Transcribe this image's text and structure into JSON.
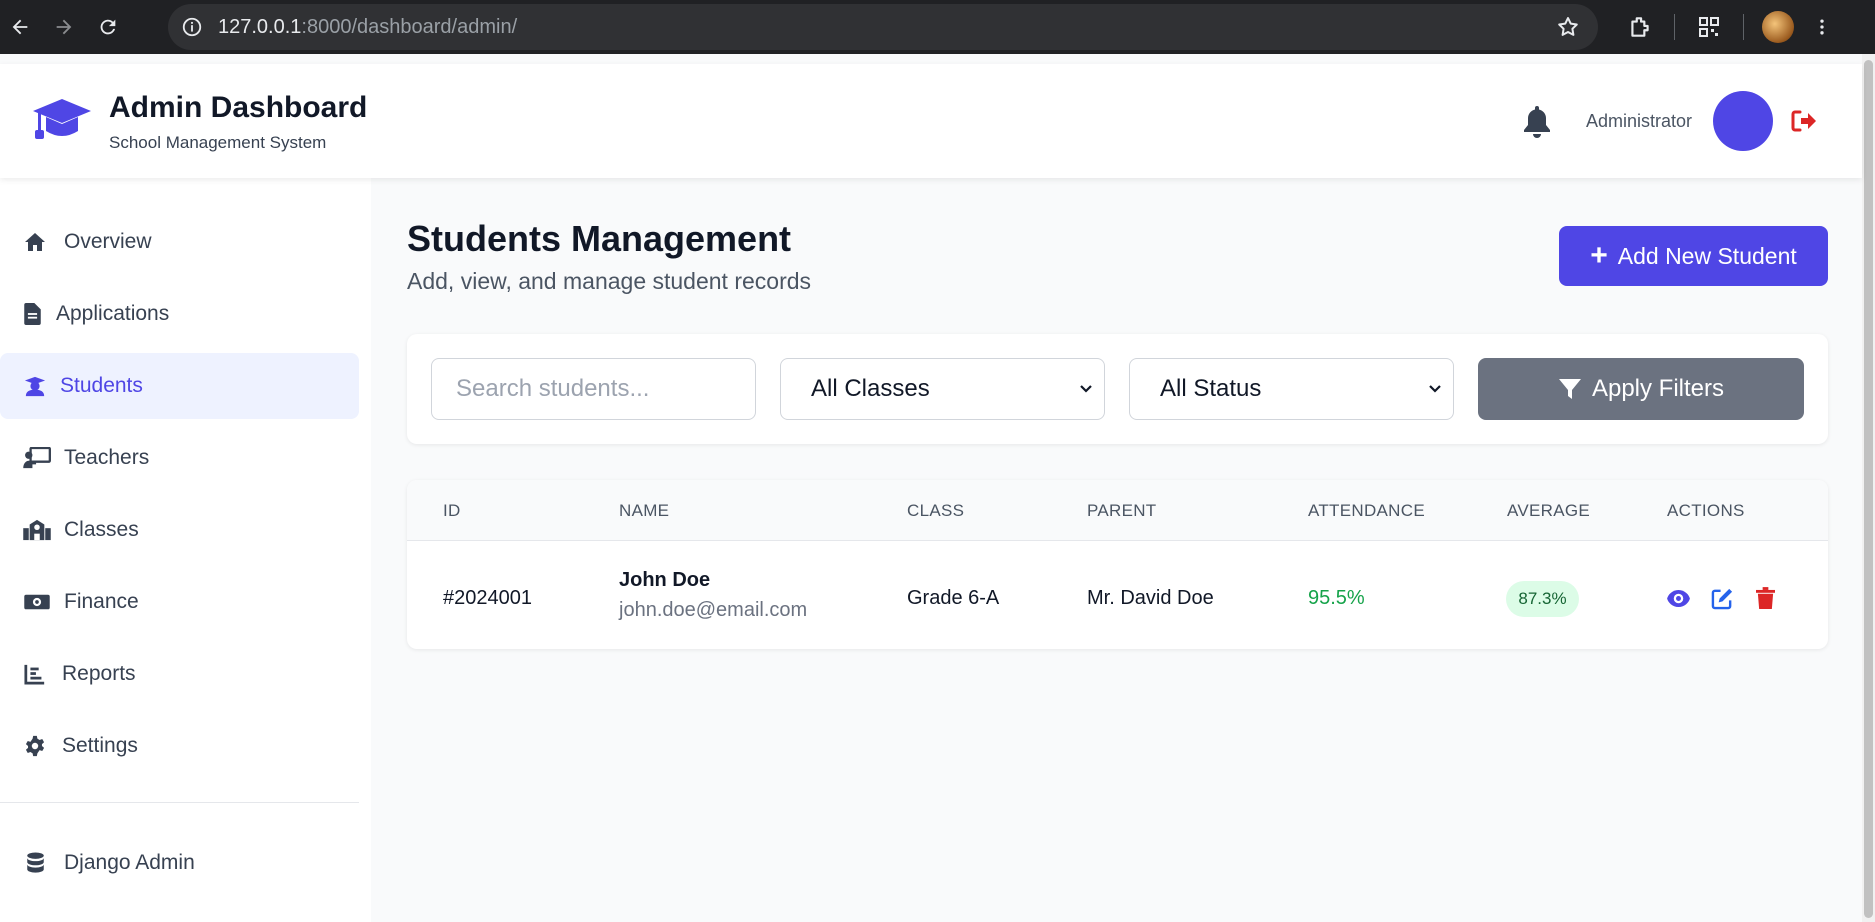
{
  "browser": {
    "url_host": "127.0.0.1",
    "url_rest": ":8000/dashboard/admin/"
  },
  "header": {
    "title": "Admin Dashboard",
    "subtitle": "School Management System",
    "user_name": "Administrator",
    "accent_color": "#4f46e5"
  },
  "sidebar": {
    "items": [
      {
        "label": "Overview",
        "icon": "home-icon"
      },
      {
        "label": "Applications",
        "icon": "file-icon"
      },
      {
        "label": "Students",
        "icon": "student-icon",
        "active": true
      },
      {
        "label": "Teachers",
        "icon": "teacher-icon"
      },
      {
        "label": "Classes",
        "icon": "school-icon"
      },
      {
        "label": "Finance",
        "icon": "money-icon"
      },
      {
        "label": "Reports",
        "icon": "chart-icon"
      },
      {
        "label": "Settings",
        "icon": "gear-icon"
      }
    ],
    "footer_item": {
      "label": "Django Admin",
      "icon": "database-icon"
    }
  },
  "main": {
    "title": "Students Management",
    "subtitle": "Add, view, and manage student records",
    "add_button": "Add New Student"
  },
  "filters": {
    "search_placeholder": "Search students...",
    "class_select": "All Classes",
    "status_select": "All Status",
    "apply_button": "Apply Filters"
  },
  "table": {
    "columns": [
      "ID",
      "NAME",
      "CLASS",
      "PARENT",
      "ATTENDANCE",
      "AVERAGE",
      "ACTIONS"
    ],
    "rows": [
      {
        "id": "#2024001",
        "name": "John Doe",
        "email": "john.doe@email.com",
        "class": "Grade 6-A",
        "parent": "Mr. David Doe",
        "attendance": "95.5%",
        "average": "87.3%"
      }
    ]
  }
}
